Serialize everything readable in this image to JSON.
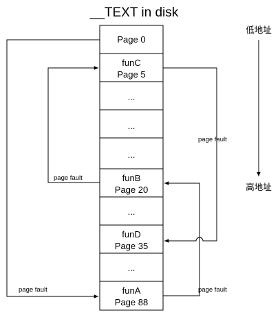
{
  "title": "__TEXT in disk",
  "pages": [
    {
      "lines": [
        "Page 0"
      ]
    },
    {
      "lines": [
        "funC",
        "Page 5"
      ]
    },
    {
      "lines": [
        "..."
      ]
    },
    {
      "lines": [
        "..."
      ]
    },
    {
      "lines": [
        "..."
      ]
    },
    {
      "lines": [
        "funB",
        "Page 20"
      ]
    },
    {
      "lines": [
        "..."
      ]
    },
    {
      "lines": [
        "funD",
        "Page 35"
      ]
    },
    {
      "lines": [
        "..."
      ]
    },
    {
      "lines": [
        "funA",
        "Page 88"
      ]
    }
  ],
  "fault_labels": {
    "funA": "page fault",
    "funB": "page fault",
    "funC": "page fault",
    "funD": "page fault"
  },
  "address_axis": {
    "low": "低地址",
    "high": "高地址"
  }
}
